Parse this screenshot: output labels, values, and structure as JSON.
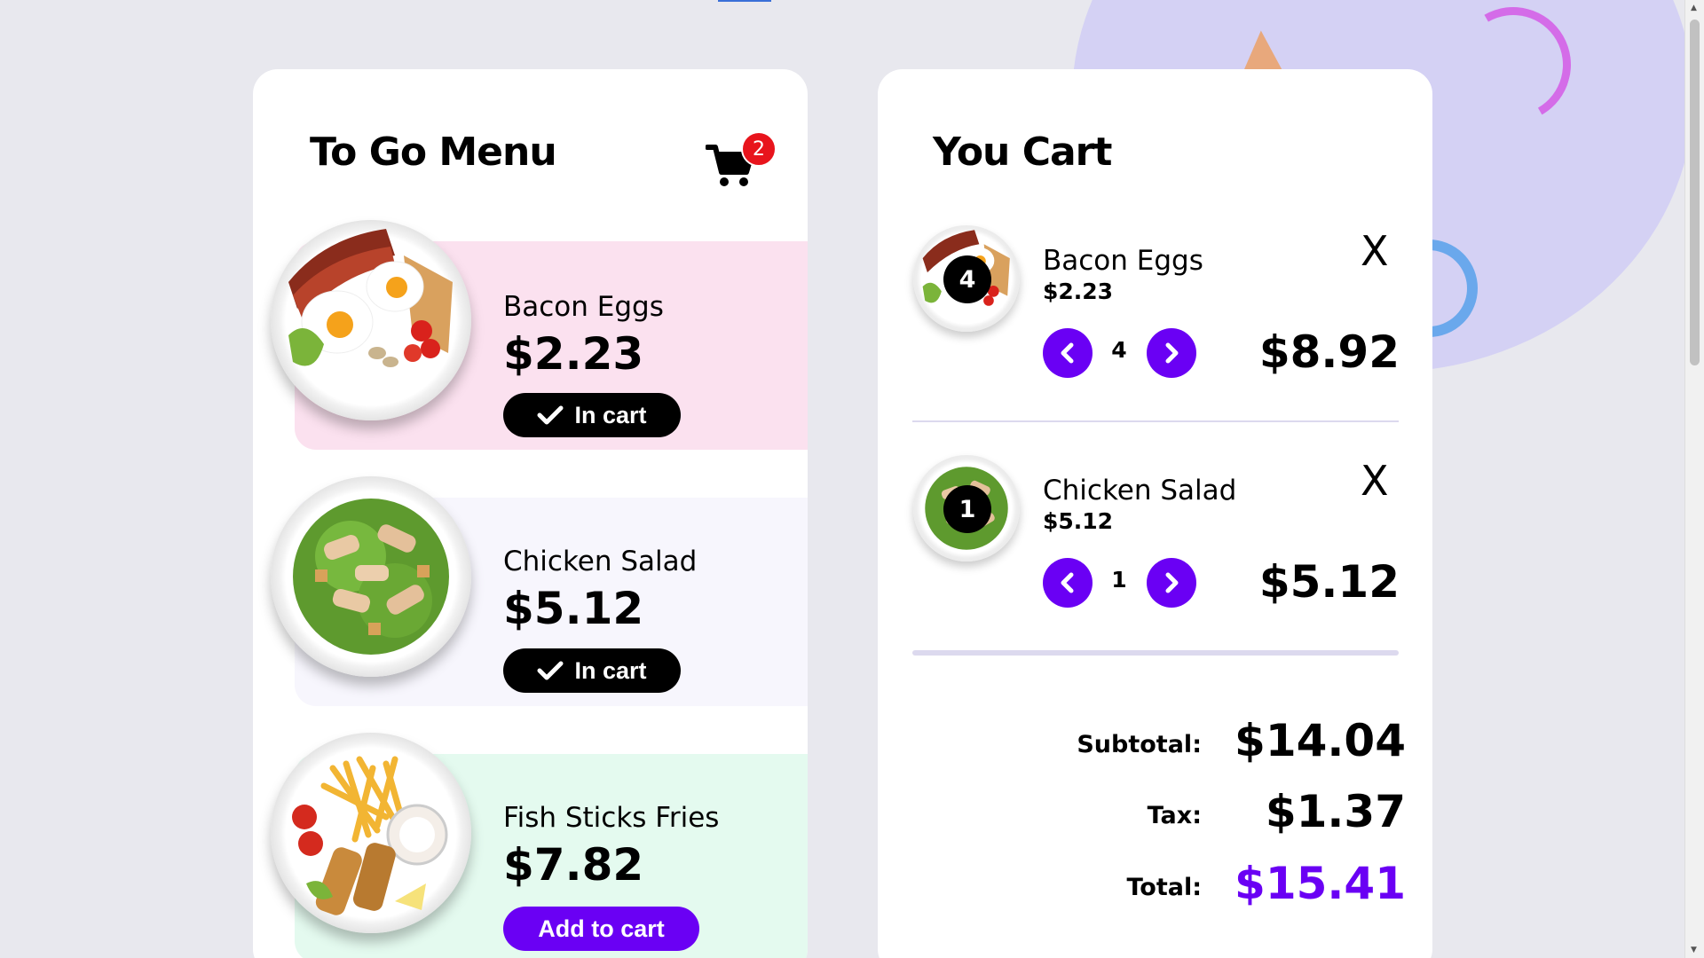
{
  "colors": {
    "accent": "#6a00f4",
    "badge": "#e8141c",
    "band_pink": "#fbe1ef",
    "band_lavender": "#f7f6fd",
    "band_mint": "#e4faef"
  },
  "menu": {
    "title": "To Go Menu",
    "cart_count": "2",
    "items": [
      {
        "name": "Bacon Eggs",
        "price": "$2.23",
        "button": "In cart",
        "in_cart": true,
        "image_icon": "bacon-eggs-plate"
      },
      {
        "name": "Chicken Salad",
        "price": "$5.12",
        "button": "In cart",
        "in_cart": true,
        "image_icon": "chicken-salad-plate"
      },
      {
        "name": "Fish Sticks Fries",
        "price": "$7.82",
        "button": "Add to cart",
        "in_cart": false,
        "image_icon": "fish-sticks-fries-plate"
      }
    ]
  },
  "cart": {
    "title": "You Cart",
    "items": [
      {
        "name": "Bacon Eggs",
        "unit_price": "$2.23",
        "qty": "4",
        "line_total": "$8.92"
      },
      {
        "name": "Chicken Salad",
        "unit_price": "$5.12",
        "qty": "1",
        "line_total": "$5.12"
      }
    ],
    "close_glyph": "X",
    "summary": {
      "subtotal_label": "Subtotal:",
      "subtotal": "$14.04",
      "tax_label": "Tax:",
      "tax": "$1.37",
      "total_label": "Total:",
      "total": "$15.41"
    }
  }
}
